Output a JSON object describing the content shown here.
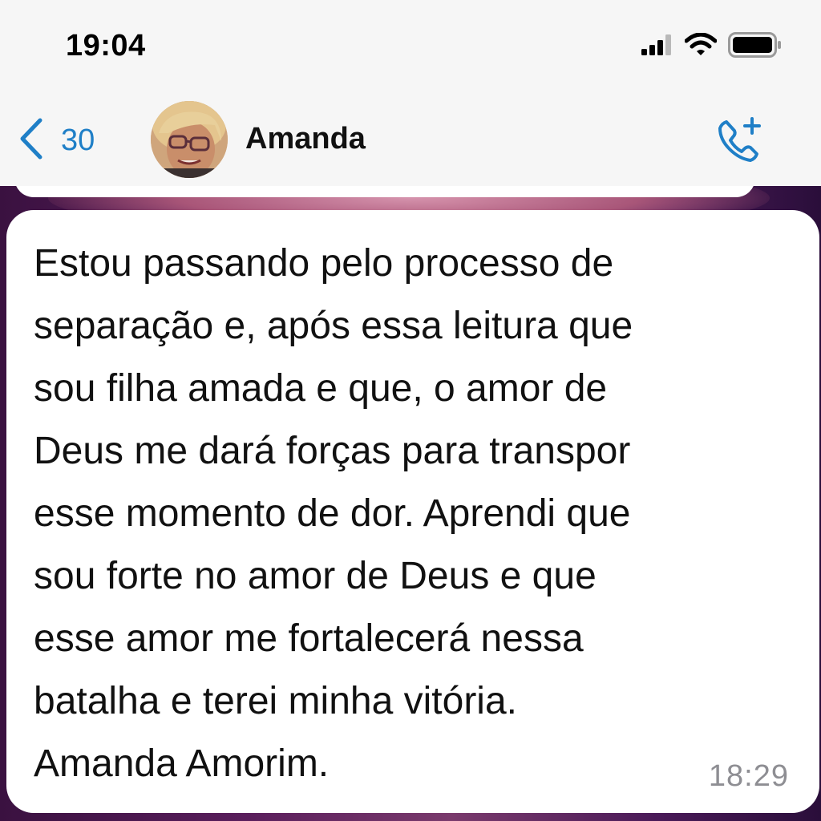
{
  "status_bar": {
    "time": "19:04",
    "signal_icon": "cellular-signal-icon",
    "wifi_icon": "wifi-icon",
    "battery_icon": "battery-icon"
  },
  "nav": {
    "back_icon": "chevron-left-icon",
    "back_count": "30",
    "contact_name": "Amanda",
    "avatar_icon": "contact-avatar",
    "call_icon": "add-call-icon",
    "accent_color": "#1f7fc7"
  },
  "chat": {
    "previous_message_partial": "……  …… ………… …………",
    "message": {
      "text": "Estou passando pelo processo de\nseparação e, após essa leitura que\nsou filha amada e que, o amor de\nDeus me dará forças para transpor\nesse momento de dor. Aprendi que\nsou forte no amor de Deus e que\nesse amor me fortalecerá nessa\nbatalha e terei minha vitória.\nAmanda Amorim.",
      "time": "18:29"
    }
  }
}
